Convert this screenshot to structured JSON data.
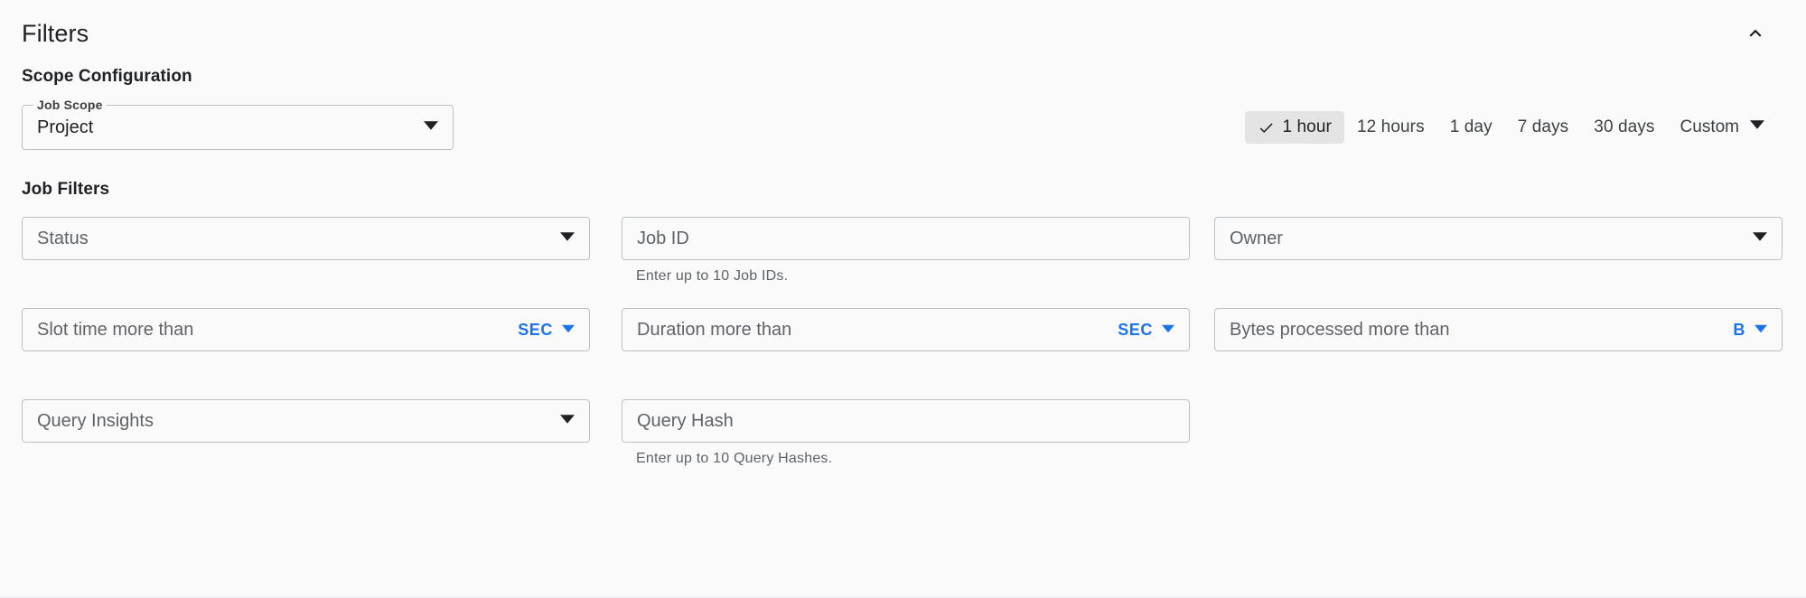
{
  "panel": {
    "title": "Filters",
    "collapse_icon": "chevron-up-icon"
  },
  "scope_section": {
    "heading": "Scope Configuration",
    "job_scope": {
      "label": "Job Scope",
      "value": "Project",
      "caret_icon": "chevron-down-icon"
    }
  },
  "time_range": {
    "options": [
      {
        "label": "1 hour",
        "selected": true
      },
      {
        "label": "12 hours",
        "selected": false
      },
      {
        "label": "1 day",
        "selected": false
      },
      {
        "label": "7 days",
        "selected": false
      },
      {
        "label": "30 days",
        "selected": false
      }
    ],
    "custom_label": "Custom",
    "custom_caret_icon": "chevron-down-icon",
    "check_icon": "check-icon",
    "selected_background": "#e4e4e4"
  },
  "job_filters": {
    "heading": "Job Filters",
    "row1": {
      "status": {
        "placeholder": "Status",
        "caret_icon": "chevron-down-icon"
      },
      "job_id": {
        "placeholder": "Job ID",
        "helper": "Enter up to 10 Job IDs."
      },
      "owner": {
        "placeholder": "Owner",
        "caret_icon": "chevron-down-icon"
      }
    },
    "row2": {
      "slot_time": {
        "placeholder": "Slot time more than",
        "unit": "SEC",
        "unit_caret_icon": "chevron-down-icon"
      },
      "duration": {
        "placeholder": "Duration more than",
        "unit": "SEC",
        "unit_caret_icon": "chevron-down-icon"
      },
      "bytes_processed": {
        "placeholder": "Bytes processed more than",
        "unit": "B",
        "unit_caret_icon": "chevron-down-icon"
      }
    },
    "row3": {
      "query_insights": {
        "placeholder": "Query Insights",
        "caret_icon": "chevron-down-icon"
      },
      "query_hash": {
        "placeholder": "Query Hash",
        "helper": "Enter up to 10 Query Hashes."
      }
    }
  },
  "colors": {
    "accent": "#1a73e8",
    "text_primary": "#202124",
    "text_secondary": "#5f6368",
    "border": "#bdc1c6",
    "background": "#fafafa"
  }
}
